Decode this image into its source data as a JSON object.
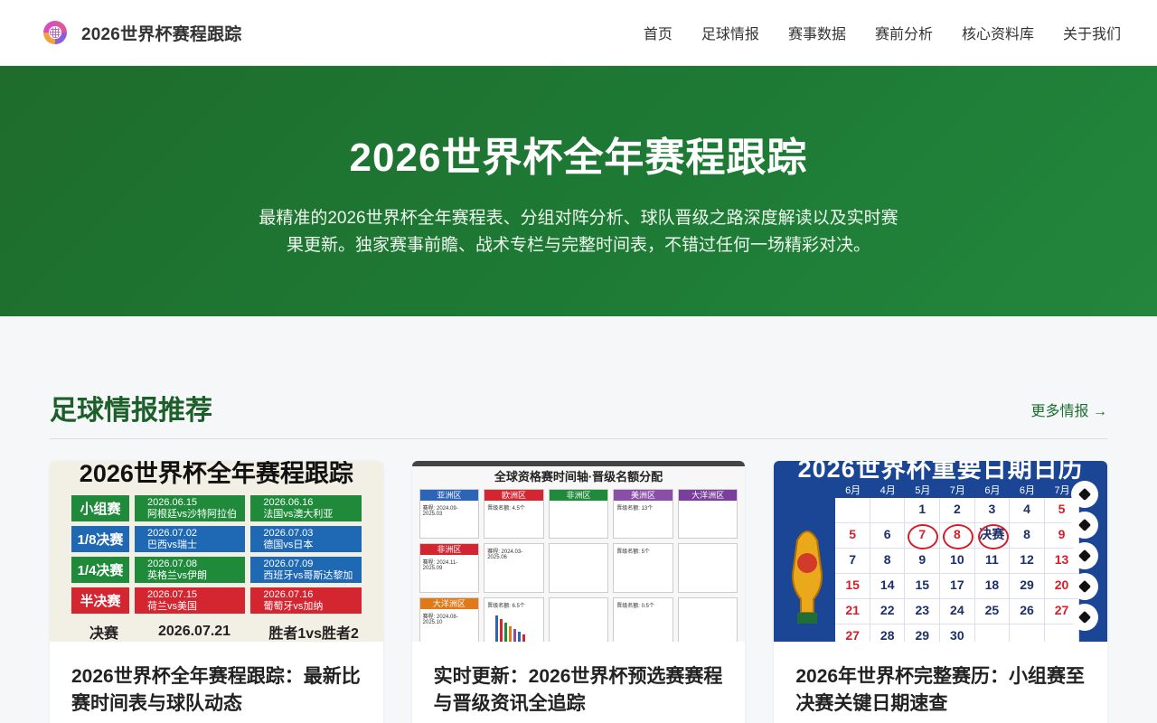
{
  "header": {
    "site_title": "2026世界杯赛程跟踪",
    "nav": [
      "首页",
      "足球情报",
      "赛事数据",
      "赛前分析",
      "核心资料库",
      "关于我们"
    ]
  },
  "hero": {
    "title": "2026世界杯全年赛程跟踪",
    "subtitle": "最精准的2026世界杯全年赛程表、分组对阵分析、球队晋级之路深度解读以及实时赛果更新。独家赛事前瞻、战术专栏与完整时间表，不错过任何一场精彩对决。"
  },
  "section": {
    "title": "足球情报推荐",
    "more_label": "更多情报 →"
  },
  "cards": [
    {
      "title": "2026世界杯全年赛程跟踪：最新比赛时间表与球队动态",
      "thumb": {
        "title": "2026世界杯全年赛程跟踪",
        "rows": [
          {
            "stage": "小组赛",
            "color": "#1e8a3a",
            "a": [
              "2026.06.15",
              "阿根廷vs沙特阿拉伯"
            ],
            "b": [
              "2026.06.16",
              "法国vs澳大利亚"
            ]
          },
          {
            "stage": "1/8决赛",
            "color": "#1f68b3",
            "a": [
              "2026.07.02",
              "巴西vs瑞士"
            ],
            "b": [
              "2026.07.03",
              "德国vs日本"
            ]
          },
          {
            "stage": "1/4决赛",
            "color": "#1e8a3a",
            "a": [
              "2026.07.08",
              "英格兰vs伊朗"
            ],
            "b": [
              "2026.07.09",
              "西班牙vs哥斯达黎加"
            ]
          },
          {
            "stage": "半决赛",
            "color": "#d42631",
            "a": [
              "2026.07.15",
              "荷兰vs美国"
            ],
            "b": [
              "2026.07.16",
              "葡萄牙vs加纳"
            ]
          }
        ],
        "final": {
          "stage": "决赛",
          "date": "2026.07.21",
          "match": "胜者1vs胜者2"
        }
      }
    },
    {
      "title": "实时更新：2026世界杯预选赛赛程与晋级资讯全追踪",
      "thumb": {
        "title": "全球资格赛时间轴·晋级名额分配",
        "zones": [
          {
            "name": "亚洲区",
            "color": "#2c64b8",
            "line": "赛程: 2024.09-2025.03"
          },
          {
            "name": "欧洲区",
            "color": "#d42631",
            "line": "晋级名额: 4.5个"
          },
          {
            "name": "非洲区",
            "color": "#1e8a3a",
            "line": ""
          },
          {
            "name": "美洲区",
            "color": "#8b4ea8",
            "line": "晋级名额: 13个"
          },
          {
            "name": "大洋洲区",
            "color": "#7a3f9c",
            "line": ""
          },
          {
            "name": "非洲区",
            "color": "#d42631",
            "line": "赛程: 2024.11-2025.09"
          },
          {
            "name": "",
            "color": "",
            "line": "赛程: 2024.03-2025.06"
          },
          {
            "name": "",
            "color": "",
            "line": ""
          },
          {
            "name": "",
            "color": "",
            "line": "晋级名额: 5个"
          },
          {
            "name": "",
            "color": "",
            "line": ""
          },
          {
            "name": "大洋洲区",
            "color": "#e07a18",
            "line": "赛程: 2024.08-2025.10"
          },
          {
            "name": "",
            "color": "",
            "line": "晋级名额: 6.5个"
          },
          {
            "name": "",
            "color": "",
            "line": ""
          },
          {
            "name": "",
            "color": "",
            "line": "晋级名额: 0.5个"
          },
          {
            "name": "",
            "color": "",
            "line": ""
          }
        ]
      }
    },
    {
      "title": "2026年世界杯完整赛历：小组赛至决赛关键日期速查",
      "thumb": {
        "title": "2026世界杯重要日期日历",
        "months": [
          "6月",
          "4月",
          "5月",
          "7月",
          "6月",
          "6月",
          "7月"
        ],
        "days": [
          {
            "d": "",
            "red": false,
            "circle": false
          },
          {
            "d": "",
            "red": false,
            "circle": false
          },
          {
            "d": "1",
            "red": false,
            "circle": false
          },
          {
            "d": "2",
            "red": false,
            "circle": false
          },
          {
            "d": "3",
            "red": false,
            "circle": false
          },
          {
            "d": "4",
            "red": false,
            "circle": false
          },
          {
            "d": "5",
            "red": true,
            "circle": false
          },
          {
            "d": "5",
            "red": true,
            "circle": false
          },
          {
            "d": "6",
            "red": false,
            "circle": false
          },
          {
            "d": "7",
            "red": true,
            "circle": true
          },
          {
            "d": "8",
            "red": true,
            "circle": true
          },
          {
            "d": "决赛",
            "red": false,
            "circle": true
          },
          {
            "d": "8",
            "red": false,
            "circle": false
          },
          {
            "d": "9",
            "red": true,
            "circle": false
          },
          {
            "d": "7",
            "red": false,
            "circle": false
          },
          {
            "d": "8",
            "red": false,
            "circle": false
          },
          {
            "d": "9",
            "red": false,
            "circle": false
          },
          {
            "d": "10",
            "red": false,
            "circle": false
          },
          {
            "d": "11",
            "red": false,
            "circle": false
          },
          {
            "d": "12",
            "red": false,
            "circle": false
          },
          {
            "d": "13",
            "red": true,
            "circle": false
          },
          {
            "d": "15",
            "red": true,
            "circle": false
          },
          {
            "d": "14",
            "red": false,
            "circle": false
          },
          {
            "d": "15",
            "red": false,
            "circle": false
          },
          {
            "d": "17",
            "red": false,
            "circle": false
          },
          {
            "d": "18",
            "red": false,
            "circle": false
          },
          {
            "d": "29",
            "red": false,
            "circle": false
          },
          {
            "d": "20",
            "red": true,
            "circle": false
          },
          {
            "d": "21",
            "red": true,
            "circle": false
          },
          {
            "d": "22",
            "red": false,
            "circle": false
          },
          {
            "d": "23",
            "red": false,
            "circle": false
          },
          {
            "d": "24",
            "red": false,
            "circle": false
          },
          {
            "d": "25",
            "red": false,
            "circle": false
          },
          {
            "d": "26",
            "red": false,
            "circle": false
          },
          {
            "d": "27",
            "red": true,
            "circle": false
          },
          {
            "d": "27",
            "red": true,
            "circle": false
          },
          {
            "d": "28",
            "red": false,
            "circle": false
          },
          {
            "d": "29",
            "red": false,
            "circle": false
          },
          {
            "d": "30",
            "red": false,
            "circle": false
          },
          {
            "d": "",
            "red": false,
            "circle": false
          },
          {
            "d": "",
            "red": false,
            "circle": false
          },
          {
            "d": "",
            "red": false,
            "circle": false
          }
        ]
      }
    }
  ]
}
